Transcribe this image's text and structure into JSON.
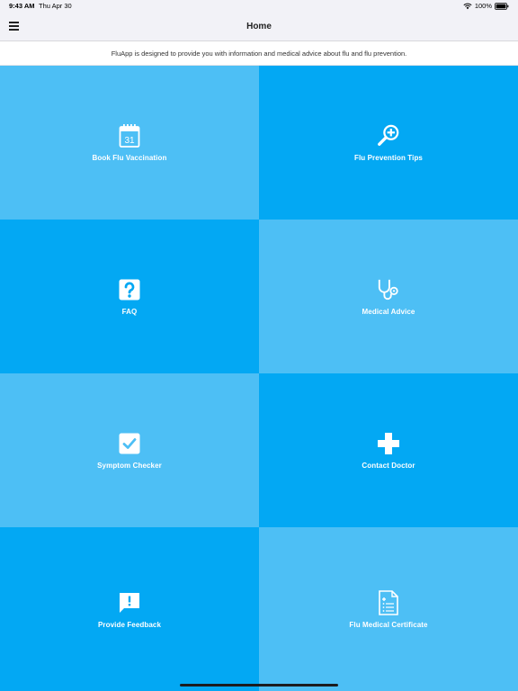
{
  "status_bar": {
    "time": "9:43 AM",
    "date": "Thu Apr 30",
    "battery": "100%",
    "icons": [
      "wifi-icon",
      "battery-icon"
    ]
  },
  "nav": {
    "title": "Home",
    "menu_icon": "hamburger-menu-icon"
  },
  "banner": {
    "text": "FluApp is designed to provide you with information and medical advice about flu and flu prevention."
  },
  "colors": {
    "tile_light": "#4dbff5",
    "tile_dark": "#03a8f3",
    "nav_bg": "#f2f2f7"
  },
  "tiles": [
    {
      "label": "Book Flu Vaccination",
      "icon": "calendar-icon",
      "calendar_day": "31"
    },
    {
      "label": "Flu Prevention Tips",
      "icon": "magnifier-plus-icon"
    },
    {
      "label": "FAQ",
      "icon": "question-icon"
    },
    {
      "label": "Medical Advice",
      "icon": "stethoscope-icon"
    },
    {
      "label": "Symptom Checker",
      "icon": "checkbox-icon"
    },
    {
      "label": "Contact Doctor",
      "icon": "medical-cross-icon"
    },
    {
      "label": "Provide Feedback",
      "icon": "feedback-bubble-icon"
    },
    {
      "label": "Flu Medical Certificate",
      "icon": "certificate-document-icon"
    }
  ]
}
